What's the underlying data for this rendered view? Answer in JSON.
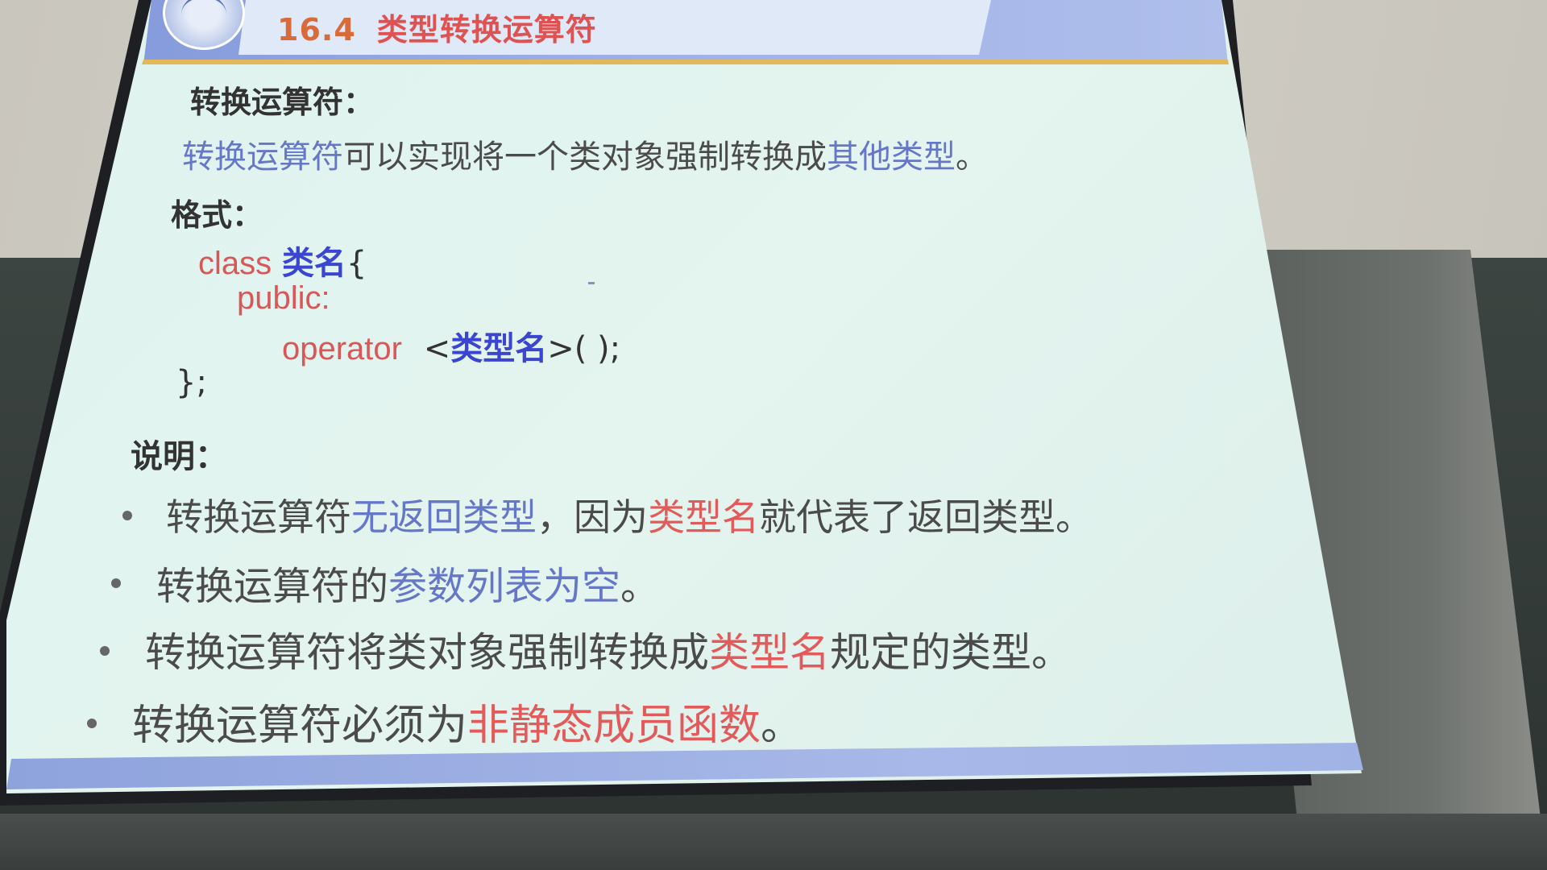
{
  "slide": {
    "title_number": "16.4",
    "title_text": "类型转换运算符"
  },
  "sections": {
    "conversion_heading": "转换运算符：",
    "conversion_desc": [
      {
        "text": "转换运算符",
        "style": "blue-soft"
      },
      {
        "text": "可以实现将一个类对象强制转换成",
        "style": "gray"
      },
      {
        "text": "其他类型",
        "style": "blue-soft"
      },
      {
        "text": "。",
        "style": "gray"
      }
    ],
    "format_heading": "格式：",
    "code": {
      "line1_kw": "class",
      "line1_name": "类名",
      "line1_brace": "{",
      "line2": "public:",
      "line3_kw": "operator",
      "line3_lt": "<",
      "line3_name": "类型名",
      "line3_rest": ">( );",
      "line4": "};"
    },
    "notes_heading": "说明：",
    "bullets": [
      [
        {
          "text": "转换运算符",
          "style": "gray"
        },
        {
          "text": "无返回类型",
          "style": "blue-soft"
        },
        {
          "text": "，因为",
          "style": "gray"
        },
        {
          "text": "类型名",
          "style": "red"
        },
        {
          "text": "就代表了返回类型。",
          "style": "gray"
        }
      ],
      [
        {
          "text": "转换运算符的",
          "style": "gray"
        },
        {
          "text": "参数列表为空",
          "style": "blue-soft"
        },
        {
          "text": "。",
          "style": "gray"
        }
      ],
      [
        {
          "text": "转换运算符将类对象强制转换成",
          "style": "gray"
        },
        {
          "text": "类型名",
          "style": "red"
        },
        {
          "text": "规定的类型。",
          "style": "gray"
        }
      ],
      [
        {
          "text": "转换运算符必须为",
          "style": "gray"
        },
        {
          "text": "非静态成员函数",
          "style": "red"
        },
        {
          "text": "。",
          "style": "gray"
        }
      ]
    ]
  },
  "colors": {
    "title_red": "#e05252",
    "accent_blue": "#6677c8",
    "keyword_blue": "#3b46d0",
    "highlight_red": "#e35a5a",
    "header_band": "#8ea2dc",
    "header_rule": "#e3b85a"
  }
}
